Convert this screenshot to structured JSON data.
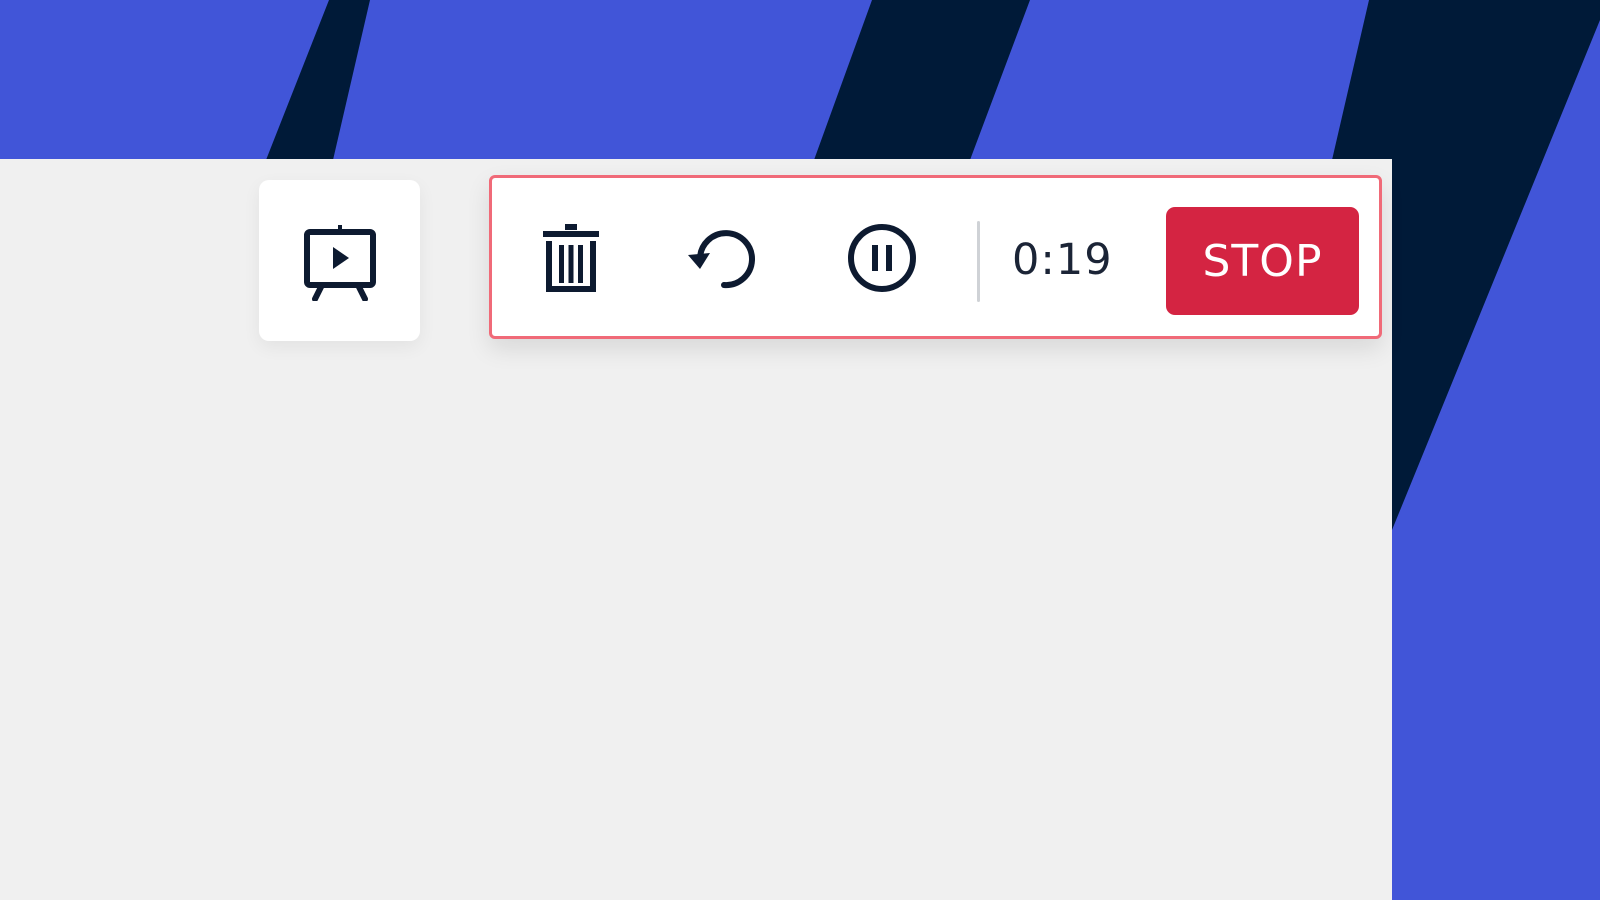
{
  "colors": {
    "backdrop_blue": "#4155d8",
    "backdrop_navy": "#001a38",
    "panel_background": "#f0f0f0",
    "recorder_border": "#f06a78",
    "stop_button": "#d42442",
    "icon_color": "#0d1a30"
  },
  "toolbar": {
    "present_icon": "presentation-play-icon"
  },
  "recorder": {
    "delete_icon": "trash-icon",
    "restart_icon": "rotate-ccw-icon",
    "pause_icon": "pause-circle-icon",
    "timer": "0:19",
    "stop_label": "STOP"
  }
}
